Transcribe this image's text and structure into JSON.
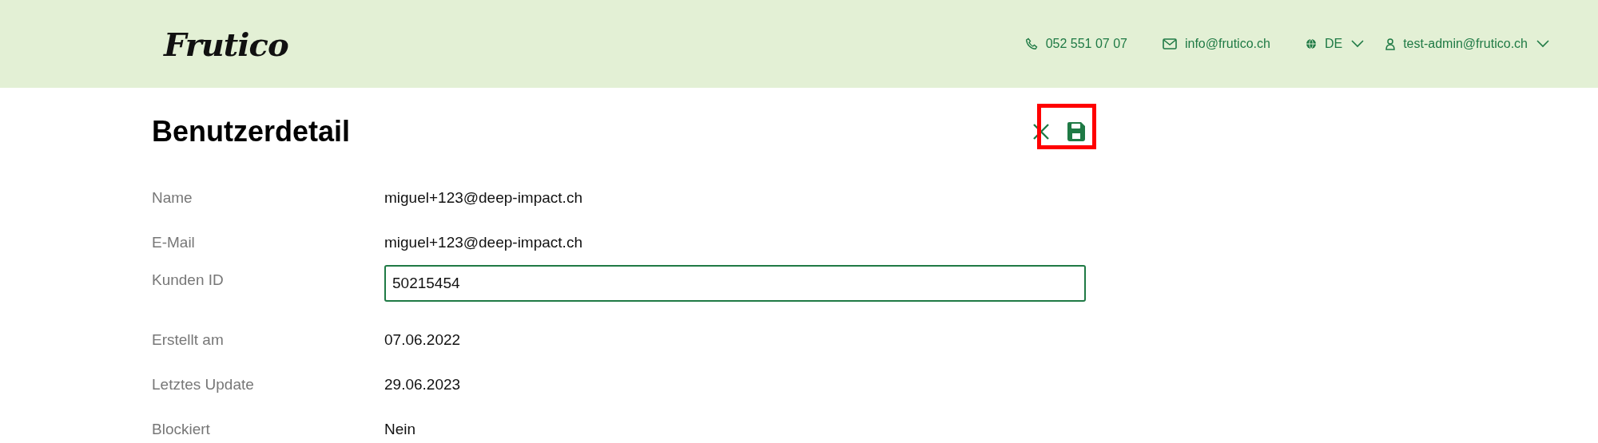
{
  "header": {
    "logo": "Frutico",
    "phone": "052 551 07 07",
    "email": "info@frutico.ch",
    "language": "DE",
    "user": "test-admin@frutico.ch"
  },
  "page": {
    "title": "Benutzerdetail",
    "highlight": true
  },
  "fields": [
    {
      "label": "Name",
      "kind": "text",
      "value": "miguel+123@deep-impact.ch"
    },
    {
      "label": "E-Mail",
      "kind": "text",
      "value": "miguel+123@deep-impact.ch"
    },
    {
      "label": "Kunden ID",
      "kind": "input",
      "value": "50215454"
    },
    {
      "label": "Erstellt am",
      "kind": "text",
      "value": "07.06.2022"
    },
    {
      "label": "Letztes Update",
      "kind": "text",
      "value": "29.06.2023"
    },
    {
      "label": "Blockiert",
      "kind": "text",
      "value": "Nein"
    }
  ]
}
